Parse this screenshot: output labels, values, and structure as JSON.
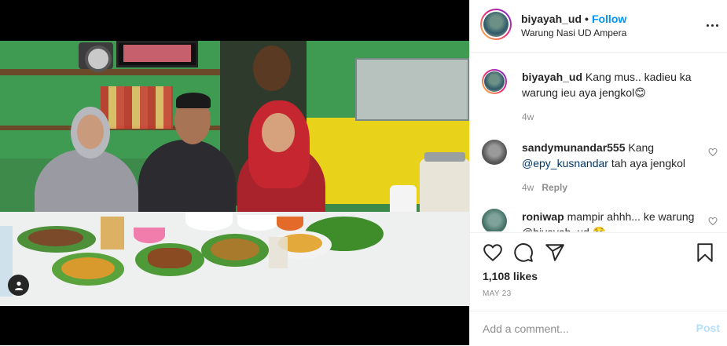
{
  "post": {
    "photo_alt": "",
    "header": {
      "username": "biyayah_ud",
      "separator": "•",
      "follow_label": "Follow",
      "location": "Warung Nasi UD Ampera"
    },
    "comments": [
      {
        "username": "biyayah_ud",
        "text": "Kang mus.. kadieu ka warung ieu aya jengkol",
        "emoji": "😊",
        "time": "4w",
        "reply_label": ""
      },
      {
        "username": "sandymunandar555",
        "text_before": "Kang",
        "mention": "@epy_kusnandar",
        "text_after": "tah aya jengkol",
        "time": "4w",
        "reply_label": "Reply"
      },
      {
        "username": "roniwap",
        "text": "mampir ahhh... ke",
        "text_cut": "warung @biyayah_ud 🤤"
      }
    ],
    "likes": "1,108 likes",
    "date": "MAY 23",
    "comment_placeholder": "Add a comment...",
    "post_label": "Post",
    "icons": {
      "more": "more-options-icon",
      "like": "heart-icon",
      "comment": "comment-icon",
      "share": "share-icon",
      "save": "bookmark-icon",
      "tag": "user-tag-icon"
    },
    "colors": {
      "accent": "#0095f6",
      "mention": "#00376b",
      "muted": "#8e8e8e",
      "post_disabled": "#b2dffc"
    }
  }
}
